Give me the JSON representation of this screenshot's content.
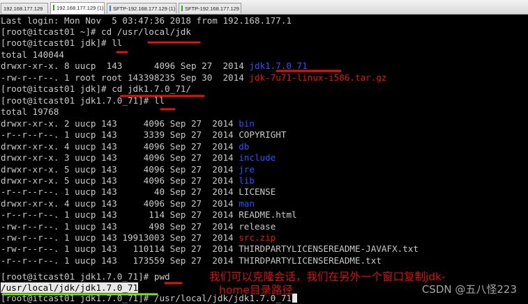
{
  "tabs": [
    {
      "label": "192.168.177.129"
    },
    {
      "label": "192.168.177.129 (1)"
    },
    {
      "label": "SFTP-192.168.177.129 (1)"
    },
    {
      "label": "SFTP-192.168.177.129"
    }
  ],
  "terminal": {
    "login": "Last login: Mon Nov  5 03:47:36 2018 from 192.168.177.1",
    "prompt1": "[root@itcast01 ~]# cd /usr/local/jdk",
    "prompt2": "[root@itcast01 jdk]# ll",
    "total1": "total 140044",
    "jdk_row": {
      "meta": "drwxr-xr-x. 8 uucp  143      4096 Sep 27  2014 ",
      "name": "jdk1.7.0_71"
    },
    "tar_row": {
      "meta": "-rw-r--r--. 1 root root 143398235 Sep 30  2014 ",
      "name": "jdk-7u71-linux-i586.tar.gz"
    },
    "prompt3": "[root@itcast01 jdk]# cd jdk1.7.0_71/",
    "prompt4": "[root@itcast01 jdk1.7.0_71]# ll",
    "total2": "total 19768",
    "listing": [
      {
        "meta": "drwxr-xr-x. 2 uucp 143     4096 Sep 27  2014 ",
        "name": "bin",
        "kind": "dir"
      },
      {
        "meta": "-r--r--r--. 1 uucp 143     3339 Sep 27  2014 ",
        "name": "COPYRIGHT",
        "kind": "file"
      },
      {
        "meta": "drwxr-xr-x. 4 uucp 143     4096 Sep 27  2014 ",
        "name": "db",
        "kind": "dir"
      },
      {
        "meta": "drwxr-xr-x. 3 uucp 143     4096 Sep 27  2014 ",
        "name": "include",
        "kind": "dir"
      },
      {
        "meta": "drwxr-xr-x. 5 uucp 143     4096 Sep 27  2014 ",
        "name": "jre",
        "kind": "dir"
      },
      {
        "meta": "drwxr-xr-x. 5 uucp 143     4096 Sep 27  2014 ",
        "name": "lib",
        "kind": "dir"
      },
      {
        "meta": "-r--r--r--. 1 uucp 143       40 Sep 27  2014 ",
        "name": "LICENSE",
        "kind": "file"
      },
      {
        "meta": "drwxr-xr-x. 4 uucp 143     4096 Sep 27  2014 ",
        "name": "man",
        "kind": "dir"
      },
      {
        "meta": "-r--r--r--. 1 uucp 143      114 Sep 27  2014 ",
        "name": "README.html",
        "kind": "file"
      },
      {
        "meta": "-rw-r--r--. 1 uucp 143      498 Sep 27  2014 ",
        "name": "release",
        "kind": "file"
      },
      {
        "meta": "-rw-r--r--. 1 uucp 143 19913003 Sep 27  2014 ",
        "name": "src.zip",
        "kind": "archive"
      },
      {
        "meta": "-rw-r--r--. 1 uucp 143   110114 Sep 27  2014 ",
        "name": "THIRDPARTYLICENSEREADME-JAVAFX.txt",
        "kind": "file"
      },
      {
        "meta": "-r--r--r--. 1 uucp 143   173559 Sep 27  2014 ",
        "name": "THIRDPARTYLICENSEREADME.txt",
        "kind": "file"
      }
    ],
    "prompt5": "[root@itcast01 jdk1.7.0_71]# pwd",
    "pwd_output": "/usr/local/jdk/jdk1.7.0_71",
    "prompt6": "[root@itcast01 jdk1.7.0_71]# /usr/local/jdk/jdk1.7.0_71"
  },
  "annotation": {
    "note_line1": "我们可以克隆会话，我们在另外一个窗口复制jdk-",
    "note_line2": "home目录路径"
  },
  "watermark": "CSDN @五八怪223",
  "colors": {
    "directory": "#2c52ff",
    "archive": "#e3140f",
    "annotation": "#e3140f",
    "highlight": "#7de51b"
  }
}
